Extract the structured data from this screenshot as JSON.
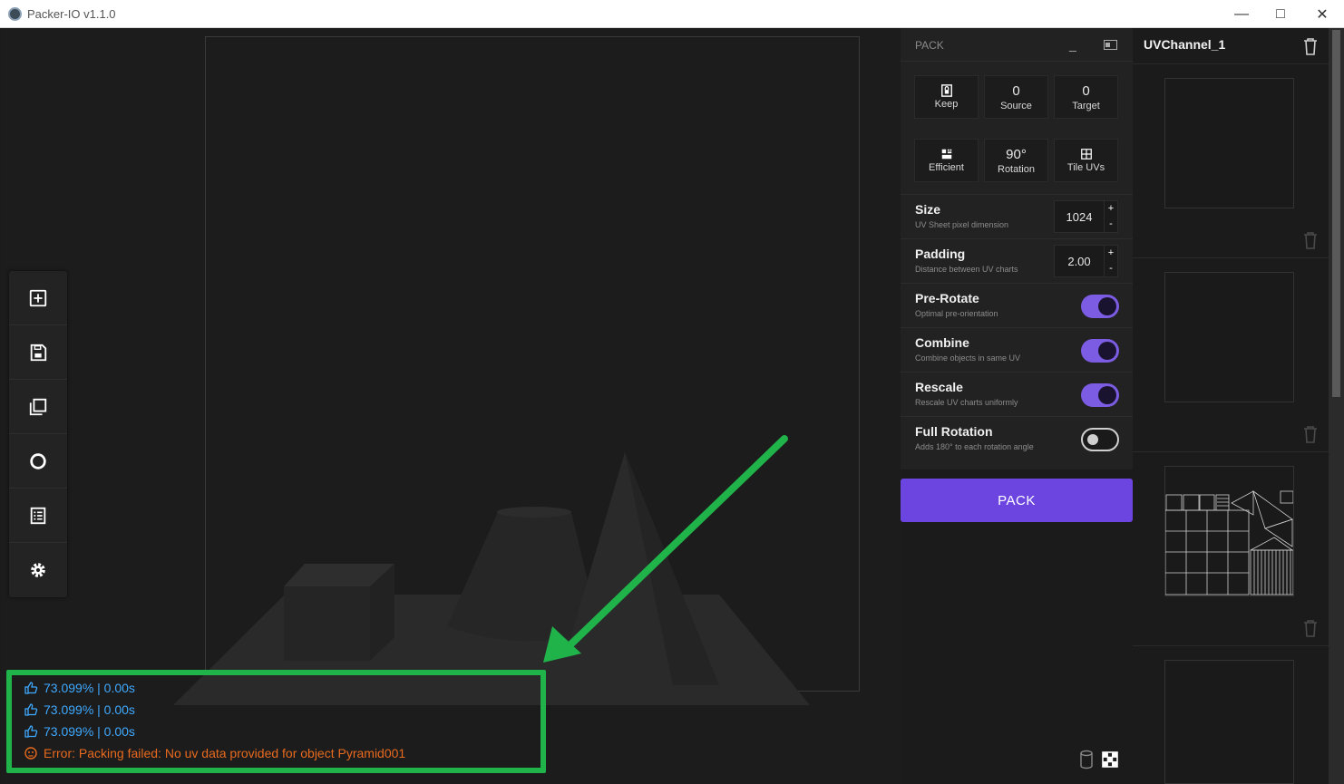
{
  "window": {
    "title": "Packer-IO v1.1.0",
    "controls": [
      "minimize",
      "maximize",
      "close"
    ]
  },
  "toolbar": {
    "items": [
      {
        "name": "add-icon"
      },
      {
        "name": "save-icon"
      },
      {
        "name": "copy-icon"
      },
      {
        "name": "circle-icon"
      },
      {
        "name": "list-icon"
      },
      {
        "name": "settings-icon"
      }
    ]
  },
  "log": {
    "entries": [
      {
        "type": "info",
        "icon": "thumbs-up-icon",
        "text": "73.099%  |  0.00s"
      },
      {
        "type": "info",
        "icon": "thumbs-up-icon",
        "text": "73.099%  |  0.00s"
      },
      {
        "type": "info",
        "icon": "thumbs-up-icon",
        "text": "73.099%  |  0.00s"
      },
      {
        "type": "error",
        "icon": "error-icon",
        "text": "Error: Packing failed: No uv data provided for object Pyramid001"
      }
    ],
    "colors": {
      "info": "#3fa9ff",
      "error": "#e86a1e",
      "highlight": "#1fb34a"
    }
  },
  "pack_panel": {
    "title": "PACK",
    "cards": [
      {
        "value": "",
        "label": "Keep",
        "icon": "lock-icon"
      },
      {
        "value": "0",
        "label": "Source"
      },
      {
        "value": "0",
        "label": "Target"
      },
      {
        "value": "",
        "label": "Efficient",
        "icon": "efficient-icon"
      },
      {
        "value": "90°",
        "label": "Rotation"
      },
      {
        "value": "",
        "label": "Tile UVs",
        "icon": "grid-icon"
      }
    ],
    "size": {
      "title": "Size",
      "subtitle": "UV Sheet pixel dimension",
      "value": "1024"
    },
    "padding": {
      "title": "Padding",
      "subtitle": "Distance between UV charts",
      "value": "2.00"
    },
    "toggles": [
      {
        "title": "Pre-Rotate",
        "subtitle": "Optimal pre-orientation",
        "on": true
      },
      {
        "title": "Combine",
        "subtitle": "Combine objects in same UV",
        "on": true
      },
      {
        "title": "Rescale",
        "subtitle": "Rescale UV charts uniformly",
        "on": true
      },
      {
        "title": "Full Rotation",
        "subtitle": "Adds 180° to each rotation angle",
        "on": false
      }
    ],
    "pack_button": "PACK",
    "accent": "#6c45e0"
  },
  "uv_channels": {
    "first_name": "UVChannel_1"
  }
}
